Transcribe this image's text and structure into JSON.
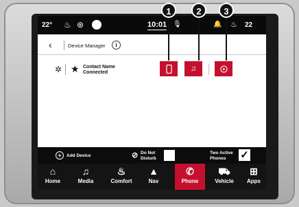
{
  "status": {
    "temp_left": "22°",
    "time": "10:01",
    "temp_right": "22"
  },
  "header": {
    "title": "Device Manager",
    "info": "i"
  },
  "device": {
    "name": "Contact Name",
    "status": "Connected"
  },
  "callouts": [
    "1",
    "2",
    "3"
  ],
  "options": {
    "add_device": "Add Device",
    "do_not_disturb": "Do Not Disturb",
    "do_not_disturb_checked": false,
    "two_active_phones": "Two Active Phones",
    "two_active_phones_checked": true
  },
  "nav": [
    {
      "label": "Home",
      "icon": "home-icon"
    },
    {
      "label": "Media",
      "icon": "music-note-icon"
    },
    {
      "label": "Comfort",
      "icon": "seat-icon"
    },
    {
      "label": "Nav",
      "icon": "navigation-arrow-icon"
    },
    {
      "label": "Phone",
      "icon": "phone-icon",
      "active": true
    },
    {
      "label": "Vehicle",
      "icon": "car-icon"
    },
    {
      "label": "Apps",
      "icon": "apps-grid-icon"
    }
  ],
  "colors": {
    "accent": "#c4102e",
    "bar": "#0a0a0a"
  }
}
